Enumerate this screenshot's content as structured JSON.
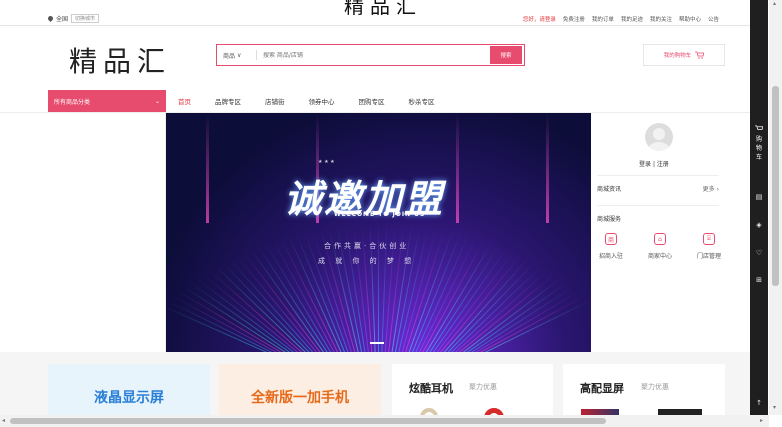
{
  "page_heading_partial": "精品汇",
  "topbar": {
    "location": "全国",
    "switch_city": "切换城市",
    "greeting": "您好，请登录",
    "links": [
      "免费注册",
      "我的订单",
      "我的足迹",
      "我的关注",
      "帮助中心",
      "公告"
    ]
  },
  "header": {
    "logo": "精品汇",
    "search_type": "商品",
    "search_placeholder": "搜索 商品/店铺",
    "search_button": "搜索",
    "cart": "我的购物车"
  },
  "nav": {
    "all_categories": "所有商品分类",
    "items": [
      "首页",
      "品牌专区",
      "店铺街",
      "领券中心",
      "团购专区",
      "秒杀专区"
    ]
  },
  "banner": {
    "headline": "诚邀加盟",
    "subtitle": "WELCOME TO JOIN US",
    "tagline": "合作共赢·合伙创业",
    "line2": "成 就 你 的 梦 想"
  },
  "user_panel": {
    "login": "登录",
    "register": "注册",
    "news_title": "商城资讯",
    "news_more": "更多",
    "services_title": "商城服务",
    "services": [
      "招商入驻",
      "商家中心",
      "门店管理"
    ]
  },
  "promos": [
    {
      "title": "液晶显示屏"
    },
    {
      "title": "全新版一加手机"
    },
    {
      "title": "炫酷耳机",
      "subtitle": "聚力优惠"
    },
    {
      "title": "高配显屏",
      "subtitle": "聚力优惠"
    }
  ],
  "sidebar": {
    "cart_label": "购物车"
  },
  "colors": {
    "accent": "#e74c6f",
    "promo_blue": "#2a7fd6",
    "promo_orange": "#e66a1a",
    "toolbar_bg": "#1f1f1f"
  }
}
